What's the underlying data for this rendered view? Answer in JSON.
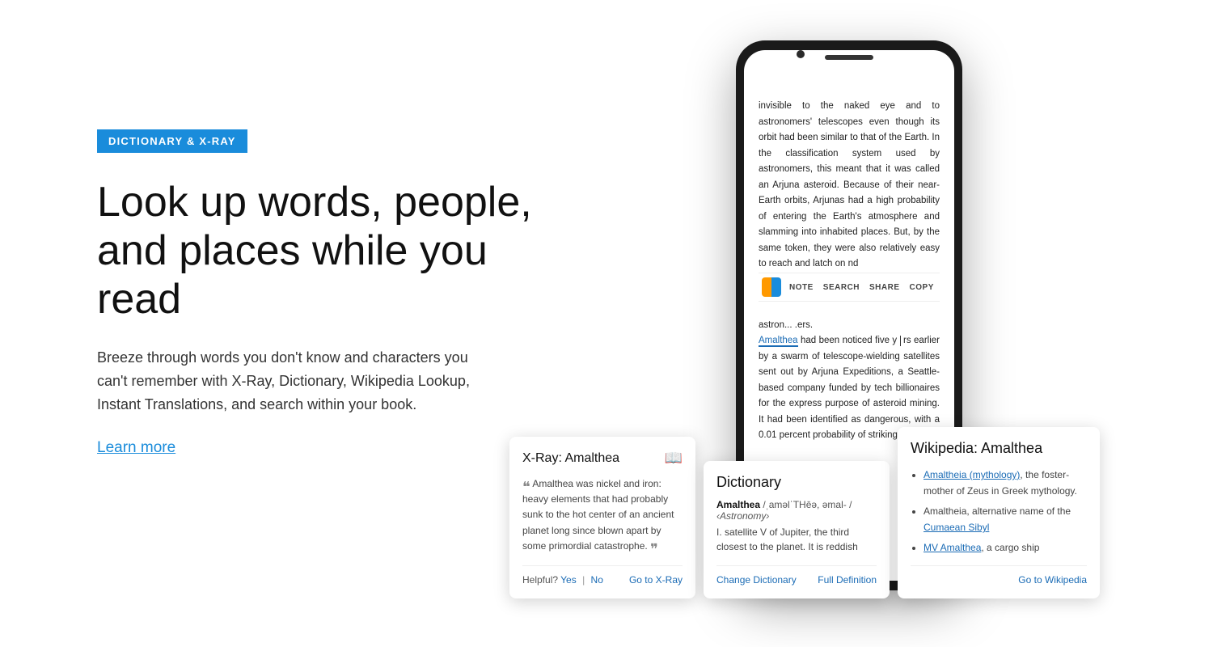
{
  "badge": {
    "label": "DICTIONARY & X-RAY"
  },
  "headline": {
    "line1": "Look up words, people,",
    "line2": "and places while you read"
  },
  "subtext": {
    "body": "Breeze through words you don't know and characters you can't remember with X-Ray, Dictionary, Wikipedia Lookup, Instant Translations, and search within your book."
  },
  "learn_more": "Learn more",
  "phone": {
    "book_text_1": "invisible to the naked eye and to astronomers' telescopes even though its orbit had been similar to that of the Earth. In the classification system used by astronomers, this meant that it was called an Arjuna asteroid. Because of their near-Earth orbits, Arjunas had a high probability of entering the Earth's atmosphere and slamming into inhabited places. But, by the same token, they were also relatively easy to reach and latch on",
    "book_text_2": "nd",
    "book_text_3": "astron...",
    "book_text_3b": ".ers.",
    "highlighted_word": "Amalthea",
    "book_text_4": " had been noticed five y",
    "book_text_5": "rs earlier",
    "book_text_6": " by a swarm of telescope-wielding satellites sent out by Arjuna Expeditions, a Seattle-based company funded by tech billionaires for the express purpose of asteroid mining. It had been identified as dangerous, with a 0.01 percent probability of striking",
    "toolbar": {
      "note": "NOTE",
      "search": "SEARCH",
      "share": "SHARE",
      "copy": "COPY"
    },
    "dots": [
      "",
      "active",
      ""
    ]
  },
  "xray_card": {
    "title": "X-Ray: Amalthea",
    "quote": "Amalthea was nickel and iron: heavy elements that had probably sunk to the hot center of an ancient planet long since blown apart by some primordial catastrophe.",
    "helpful_label": "Helpful?",
    "yes": "Yes",
    "no": "No",
    "go_to": "Go to X-Ray"
  },
  "dict_card": {
    "title": "Dictionary",
    "word": "Amalthea",
    "pronunciation": "/ˌaməlˈTHēə, əmal- /",
    "category": "‹Astronomy›",
    "definition": "I. satellite V of Jupiter, the third closest to the planet. It is reddish",
    "change": "Change Dictionary",
    "full_def": "Full Definition"
  },
  "wiki_card": {
    "title": "Wikipedia: Amalthea",
    "items": [
      {
        "link_text": "Amaltheia (mythology)",
        "rest": ", the foster-mother of Zeus in Greek mythology."
      },
      {
        "prefix": "Amaltheia, alternative name of the ",
        "link_text": "Cumaean Sibyl"
      },
      {
        "link_text": "MV Amalthea",
        "rest": ", a cargo ship"
      }
    ],
    "go_to": "Go to Wikipedia"
  }
}
